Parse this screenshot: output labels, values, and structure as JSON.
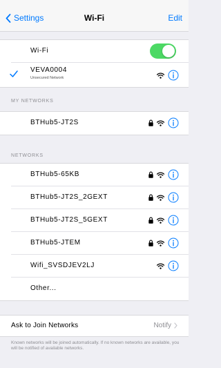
{
  "nav": {
    "back_label": "Settings",
    "title": "Wi-Fi",
    "edit_label": "Edit"
  },
  "wifi_toggle": {
    "label": "Wi-Fi",
    "on": true
  },
  "connected": {
    "name": "VEVA0004",
    "subtitle": "Unsecured Network"
  },
  "my_networks": {
    "header": "MY NETWORKS",
    "items": [
      {
        "name": "BTHub5-JT2S",
        "secured": true
      }
    ]
  },
  "networks": {
    "header": "NETWORKS",
    "items": [
      {
        "name": "BTHub5-65KB",
        "secured": true
      },
      {
        "name": "BTHub5-JT2S_2GEXT",
        "secured": true
      },
      {
        "name": "BTHub5-JT2S_5GEXT",
        "secured": true
      },
      {
        "name": "BTHub5-JTEM",
        "secured": true
      },
      {
        "name": "Wifi_SVSDJEV2LJ",
        "secured": false
      }
    ],
    "other_label": "Other..."
  },
  "ask_to_join": {
    "label": "Ask to Join Networks",
    "value": "Notify",
    "footer": "Known networks will be joined automatically. If no known networks are available, you will be notified of available networks."
  },
  "colors": {
    "accent": "#007aff",
    "toggle_on": "#4cd964",
    "background": "#efeff4"
  }
}
